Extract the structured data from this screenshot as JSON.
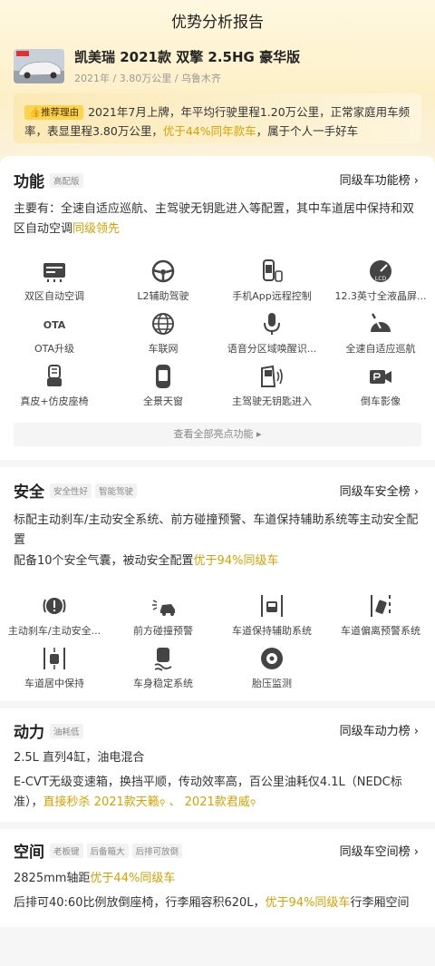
{
  "header": {
    "title": "优势分析报告"
  },
  "car": {
    "name": "凯美瑞 2021款 双擎 2.5HG 豪华版",
    "year": "2021年",
    "mileage": "3.80万公里",
    "city": "乌鲁木齐",
    "sep": "/"
  },
  "recommendation": {
    "badge": "推荐理由",
    "text_a": "2021年7月上牌，年平均行驶里程1.20万公里，正常家庭用车频率，表显里程3.80万公里，",
    "highlight": "优于44%同年款车",
    "text_b": "，属于个人一手好车"
  },
  "function": {
    "title": "功能",
    "tag": "高配版",
    "rank": "同级车功能榜",
    "desc_a": "主要有：全速自适应巡航、主驾驶无钥匙进入等配置，其中车道居中保持和双区自动空调",
    "desc_hl": "同级领先",
    "items": [
      {
        "label": "双区自动空调",
        "icon": "climate-icon"
      },
      {
        "label": "L2辅助驾驶",
        "icon": "steering-wheel-icon"
      },
      {
        "label": "手机App远程控制",
        "icon": "phone-car-icon"
      },
      {
        "label": "12.3英寸全液晶屏...",
        "icon": "lcd-gauge-icon"
      },
      {
        "label": "OTA升级",
        "icon": "ota-icon"
      },
      {
        "label": "车联网",
        "icon": "globe-icon"
      },
      {
        "label": "语音分区域唤醒识...",
        "icon": "microphone-icon"
      },
      {
        "label": "全速自适应巡航",
        "icon": "cruise-icon"
      },
      {
        "label": "真皮+仿皮座椅",
        "icon": "seat-icon"
      },
      {
        "label": "全景天窗",
        "icon": "sunroof-icon"
      },
      {
        "label": "主驾驶无钥匙进入",
        "icon": "keyless-door-icon"
      },
      {
        "label": "倒车影像",
        "icon": "camera-icon"
      }
    ],
    "ota_text": "OTA",
    "lcd_text": "LCD",
    "view_all": "查看全部亮点功能 ▸"
  },
  "safety": {
    "title": "安全",
    "tags": [
      "安全性好",
      "智能驾驶"
    ],
    "rank": "同级车安全榜",
    "desc1": "标配主动刹车/主动安全系统、前方碰撞预警、车道保持辅助系统等主动安全配置",
    "desc2_a": "配备10个安全气囊，被动安全配置",
    "desc2_hl": "优于94%同级车",
    "items": [
      {
        "label": "主动刹车/主动安全...",
        "icon": "brake-icon"
      },
      {
        "label": "前方碰撞预警",
        "icon": "collision-icon"
      },
      {
        "label": "车道保持辅助系统",
        "icon": "lane-keep-icon"
      },
      {
        "label": "车道偏离预警系统",
        "icon": "lane-departure-icon"
      },
      {
        "label": "车道居中保持",
        "icon": "lane-center-icon"
      },
      {
        "label": "车身稳定系统",
        "icon": "stability-icon"
      },
      {
        "label": "胎压监测",
        "icon": "tire-icon"
      }
    ]
  },
  "power": {
    "title": "动力",
    "tag": "油耗低",
    "rank": "同级车动力榜",
    "line1": "2.5L 直列4缸，油电混合",
    "line2": "E-CVT无级变速箱，换挡平顺，传动效率高，百公里油耗仅4.1L（NEDC标准），",
    "hl_prefix": "直接秒杀",
    "hl_car1": "2021款天籁",
    "sep": "、",
    "hl_car2": "2021款君威"
  },
  "space": {
    "title": "空间",
    "tags": [
      "老板键",
      "后备箱大",
      "后排可放倒"
    ],
    "rank": "同级车空间榜",
    "line1_a": "2825mm轴距",
    "line1_hl": "优于44%同级车",
    "line2_a": "后排可40:60比例放倒座椅，行李厢容积620L，",
    "line2_hl": "优于94%同级车",
    "line2_b": "行李厢空间"
  },
  "colors": {
    "accent": "#d9a100",
    "badge": "#fbd34d"
  }
}
